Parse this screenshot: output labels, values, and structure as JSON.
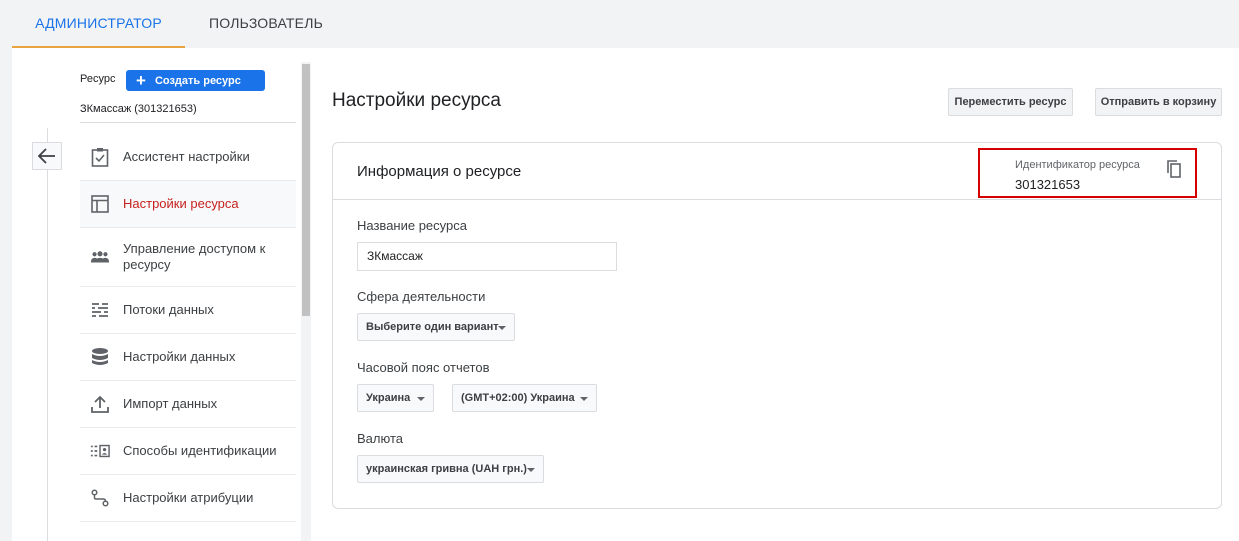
{
  "tabs": [
    {
      "label": "АДМИНИСТРАТОР",
      "active": true
    },
    {
      "label": "ПОЛЬЗОВАТЕЛЬ",
      "active": false
    }
  ],
  "sidebar": {
    "property_label": "Ресурс",
    "create_button": "Создать ресурс",
    "property_name": "ЗКмассаж (301321653)",
    "items": [
      {
        "label": "Ассистент настройки",
        "icon": "checklist-icon"
      },
      {
        "label": "Настройки ресурса",
        "icon": "layout-icon",
        "active": true
      },
      {
        "label": "Управление доступом к ресурсу",
        "icon": "people-icon"
      },
      {
        "label": "Потоки данных",
        "icon": "data-streams-icon"
      },
      {
        "label": "Настройки данных",
        "icon": "database-icon"
      },
      {
        "label": "Импорт данных",
        "icon": "upload-icon"
      },
      {
        "label": "Способы идентификации",
        "icon": "identity-icon"
      },
      {
        "label": "Настройки атрибуции",
        "icon": "attribution-icon"
      }
    ]
  },
  "main": {
    "title": "Настройки ресурса",
    "move_button": "Переместить ресурс",
    "trash_button": "Отправить в корзину",
    "card": {
      "title": "Информация о ресурсе",
      "id_label": "Идентификатор ресурса",
      "id_value": "301321653",
      "name_label": "Название ресурса",
      "name_value": "ЗКмассаж",
      "industry_label": "Сфера деятельности",
      "industry_value": "Выберите один вариант",
      "timezone_label": "Часовой пояс отчетов",
      "timezone_country": "Украина",
      "timezone_value": "(GMT+02:00) Украина",
      "currency_label": "Валюта",
      "currency_value": "украинская гривна (UAH грн.)"
    }
  },
  "colors": {
    "accent": "#1a73e8",
    "active_nav": "#c5221f",
    "tab_indicator": "#e8a33d",
    "highlight_box": "#d50000"
  }
}
